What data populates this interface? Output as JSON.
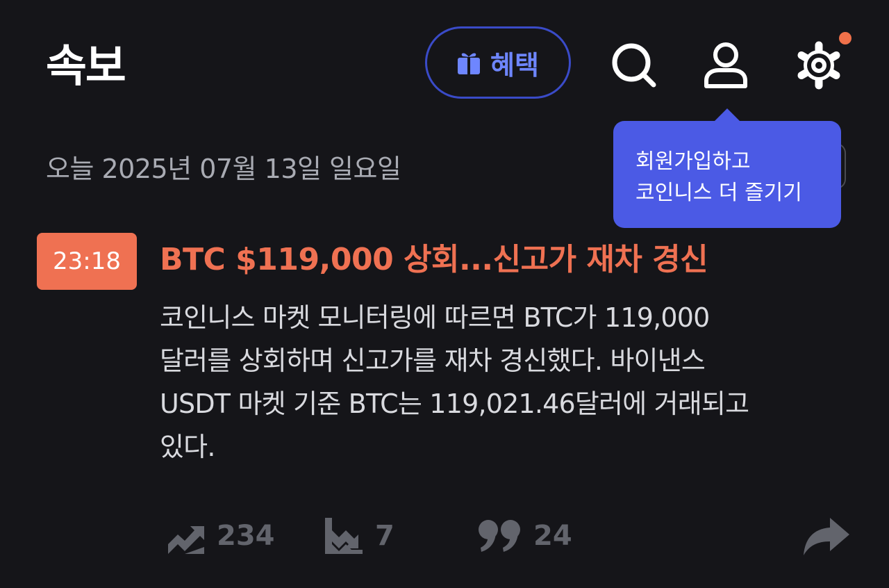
{
  "header": {
    "title": "속보",
    "benefit_label": "혜택",
    "icons": [
      "gift-icon",
      "search-icon",
      "user-icon",
      "gear-icon"
    ]
  },
  "date_line": "오늘 2025년 07월 13일 일요일",
  "tooltip": {
    "line1": "회원가입하고",
    "line2": "코인니스 더 즐기기"
  },
  "news": {
    "time": "23:18",
    "headline": "BTC $119,000 상회...신고가 재차 경신",
    "body_lines": [
      "코인니스 마켓 모니터링에 따르면 BTC가 119,000",
      "달러를 상회하며 신고가를 재차 경신했다. 바이낸스",
      "USDT 마켓 기준 BTC는 119,021.46달러에 거래되고",
      "있다."
    ]
  },
  "actions": {
    "bullish_count": "234",
    "bearish_count": "7",
    "comment_count": "24"
  },
  "colors": {
    "background": "#151519",
    "accent_orange": "#ef7152",
    "accent_blue": "#4b5ae5",
    "muted": "#62646c"
  }
}
